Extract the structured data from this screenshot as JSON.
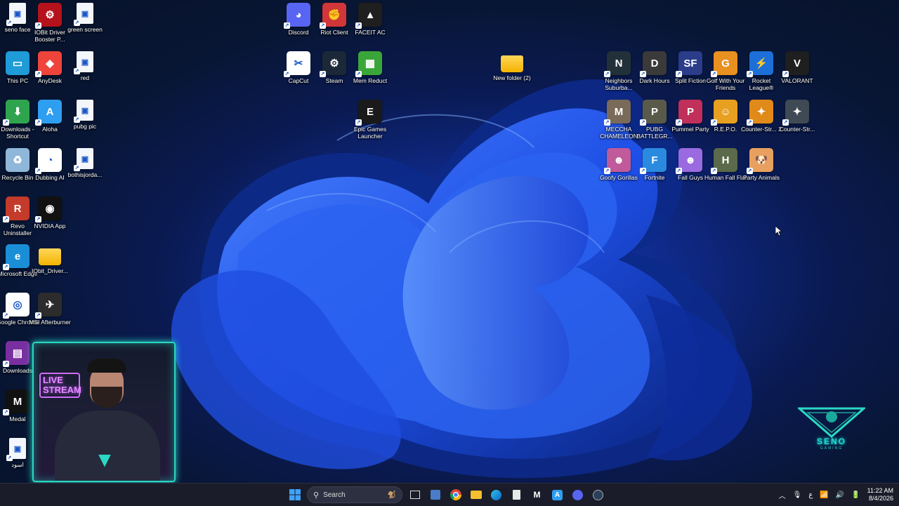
{
  "desktop": {
    "icons": [
      {
        "label": "seno face",
        "icon": "image-file-icon",
        "color": "#f3f6fb",
        "kind": "file"
      },
      {
        "label": "IOBit Driver Booster P...",
        "icon": "iobit-driver-booster-icon",
        "color": "#b5121b"
      },
      {
        "label": "green screen",
        "icon": "image-file-icon",
        "color": "#f3f6fb",
        "kind": "file"
      },
      {
        "label": "This PC",
        "icon": "monitor-icon",
        "color": "#1f9bd7"
      },
      {
        "label": "AnyDesk",
        "icon": "anydesk-icon",
        "color": "#ef443b"
      },
      {
        "label": "red",
        "icon": "image-file-icon",
        "color": "#f3f6fb",
        "kind": "file"
      },
      {
        "label": "Downloads - Shortcut",
        "icon": "downloads-folder-icon",
        "color": "#2ea44f"
      },
      {
        "label": "Aloha",
        "icon": "aloha-icon",
        "color": "#2e9ef0"
      },
      {
        "label": "pubg pic",
        "icon": "image-file-icon",
        "color": "#f3f6fb",
        "kind": "file"
      },
      {
        "label": "Recycle Bin",
        "icon": "recycle-bin-icon",
        "color": "#8fb7d9"
      },
      {
        "label": "Dubbing AI",
        "icon": "dubbing-ai-icon",
        "color": "#ffffff"
      },
      {
        "label": "bothisjorda...",
        "icon": "image-file-icon",
        "color": "#f3f6fb",
        "kind": "file"
      },
      {
        "label": "Revo Uninstaller",
        "icon": "revo-uninstaller-icon",
        "color": "#c43b2c"
      },
      {
        "label": "NVIDIA App",
        "icon": "nvidia-icon",
        "color": "#111111"
      },
      {
        "label": "Microsoft Edge",
        "icon": "edge-icon",
        "color": "#1a8fd8"
      },
      {
        "label": "IObit_Driver...",
        "icon": "folder-icon",
        "color": "#f4b400",
        "kind": "folder"
      },
      {
        "label": "Google Chrome",
        "icon": "chrome-icon",
        "color": "#ffffff"
      },
      {
        "label": "MSI Afterburner",
        "icon": "msi-afterburner-icon",
        "color": "#2c2c2c"
      },
      {
        "label": "Downloads",
        "icon": "winrar-icon",
        "color": "#7a2fa0"
      },
      {
        "label": "Medal",
        "icon": "medal-icon",
        "color": "#111111"
      },
      {
        "label": "اسود",
        "icon": "image-file-icon",
        "color": "#f3f6fb",
        "kind": "file"
      },
      {
        "label": "Discord",
        "icon": "discord-icon",
        "color": "#5865f2"
      },
      {
        "label": "Riot Client",
        "icon": "riot-client-icon",
        "color": "#d13639"
      },
      {
        "label": "FACEIT AC",
        "icon": "faceit-icon",
        "color": "#1f1f1f"
      },
      {
        "label": "CapCut",
        "icon": "capcut-icon",
        "color": "#ffffff"
      },
      {
        "label": "Steam",
        "icon": "steam-icon",
        "color": "#1b2838"
      },
      {
        "label": "Mem Reduct",
        "icon": "mem-reduct-icon",
        "color": "#3aa63a"
      },
      {
        "label": "Epic Games Launcher",
        "icon": "epic-games-icon",
        "color": "#1a1a1a"
      },
      {
        "label": "New folder (2)",
        "icon": "folder-icon",
        "color": "#f4b400",
        "kind": "folder"
      },
      {
        "label": "Neighbors Suburba...",
        "icon": "neighbors-icon",
        "color": "#22303a"
      },
      {
        "label": "Dark Hours",
        "icon": "dark-hours-icon",
        "color": "#3a3a3a"
      },
      {
        "label": "Split Fiction",
        "icon": "split-fiction-icon",
        "color": "#2b3c8a"
      },
      {
        "label": "Golf With Your Friends",
        "icon": "golf-icon",
        "color": "#e89020"
      },
      {
        "label": "Rocket League®",
        "icon": "rocket-league-icon",
        "color": "#1c6fd8"
      },
      {
        "label": "VALORANT",
        "icon": "valorant-icon",
        "color": "#1f1f1f"
      },
      {
        "label": "MECCHA CHAMELEON",
        "icon": "meccha-chameleon-icon",
        "color": "#7a6a5a"
      },
      {
        "label": "PUBG BATTLEGR...",
        "icon": "pubg-icon",
        "color": "#5a5a4a"
      },
      {
        "label": "Pummel Party",
        "icon": "pummel-party-icon",
        "color": "#c0305a"
      },
      {
        "label": "R.E.P.O.",
        "icon": "repo-icon",
        "color": "#e8a020"
      },
      {
        "label": "Counter-Str... 2",
        "icon": "counter-strike-2-icon",
        "color": "#e08a1a"
      },
      {
        "label": "Counter-Str...",
        "icon": "counter-strike-icon",
        "color": "#404a55"
      },
      {
        "label": "Goofy Gorillas",
        "icon": "goofy-gorillas-icon",
        "color": "#c05a9a"
      },
      {
        "label": "Fortnite",
        "icon": "fortnite-icon",
        "color": "#2a8ae0"
      },
      {
        "label": "Fall Guys",
        "icon": "fall-guys-icon",
        "color": "#9a6ae0"
      },
      {
        "label": "Human Fall Flat",
        "icon": "human-fall-flat-icon",
        "color": "#5a6a4a"
      },
      {
        "label": "Party Animals",
        "icon": "party-animals-icon",
        "color": "#e8a060"
      }
    ]
  },
  "webcam": {
    "badge": "LIVE STREAM"
  },
  "brand": {
    "name": "SENO",
    "sub": "GAMING"
  },
  "taskbar": {
    "search_label": "Search",
    "apps": [
      "start-icon",
      "task-view-icon",
      "chrome-icon",
      "file-explorer-icon",
      "edge-icon",
      "notepad-icon",
      "medal-icon",
      "aloha-icon",
      "discord-icon",
      "steam-icon"
    ],
    "tray": {
      "language": "ع",
      "time": "11:22 AM",
      "date": "8/4/2026"
    }
  }
}
